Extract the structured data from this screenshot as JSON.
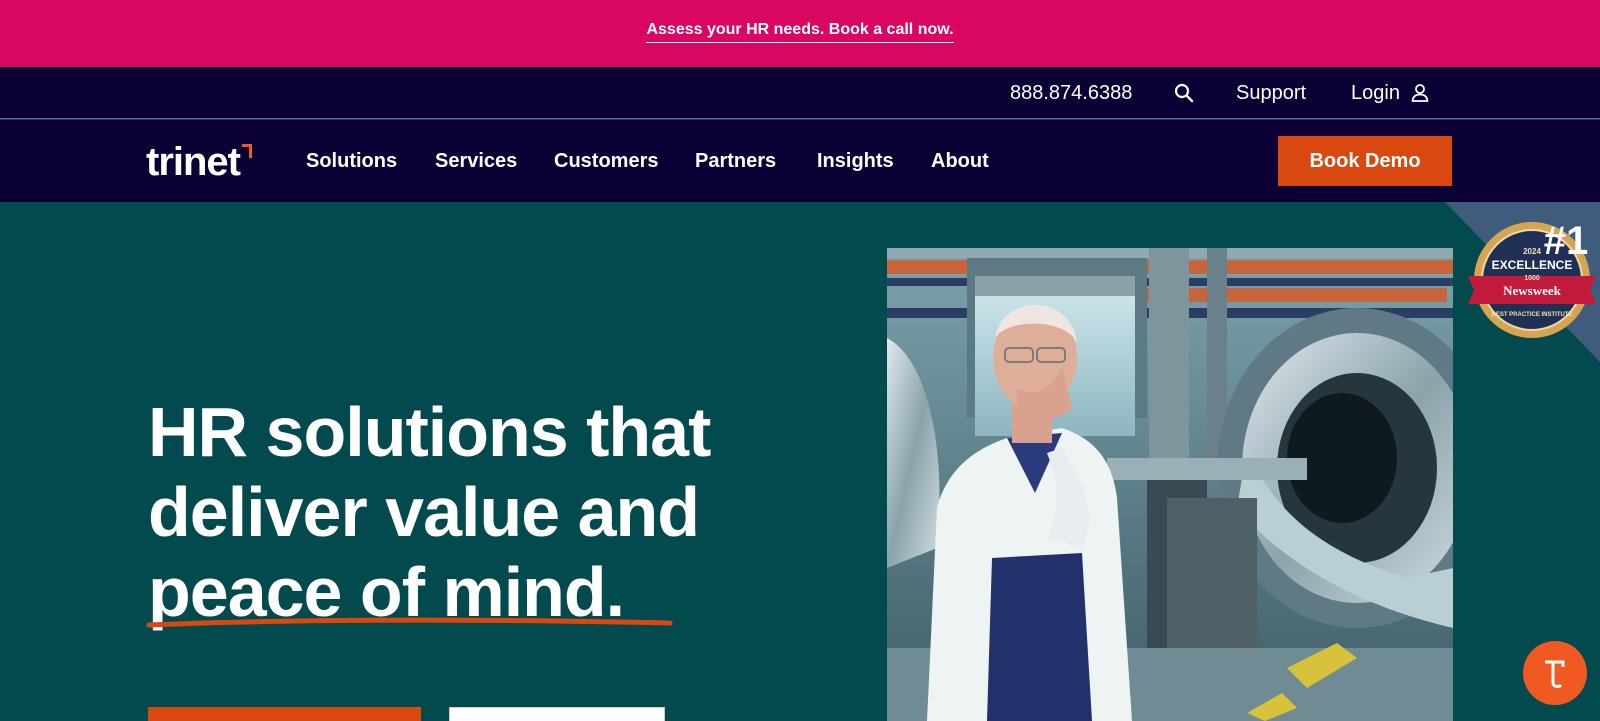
{
  "promo": {
    "link_text": "Assess your HR needs. Book a call now."
  },
  "utility": {
    "phone": "888.874.6388",
    "support": "Support",
    "login": "Login"
  },
  "nav": {
    "brand": "trinet",
    "items": [
      "Solutions",
      "Services",
      "Customers",
      "Partners",
      "Insights",
      "About"
    ],
    "cta": "Book Demo"
  },
  "hero": {
    "headline_lines": [
      "HR solutions that",
      "deliver value and",
      "peace of mind."
    ]
  },
  "badge": {
    "rank": "#1",
    "year": "2024",
    "title": "EXCELLENCE",
    "sub": "1000",
    "publisher": "Newsweek",
    "institute": "BEST PRACTICE INSTITUTE"
  },
  "colors": {
    "promo_bg": "#DA0760",
    "nav_bg": "#0B0033",
    "hero_bg": "#024A4E",
    "accent": "#D9480F"
  },
  "icons": {
    "search": "search-icon",
    "login": "user-icon",
    "chat": "chat-icon"
  }
}
